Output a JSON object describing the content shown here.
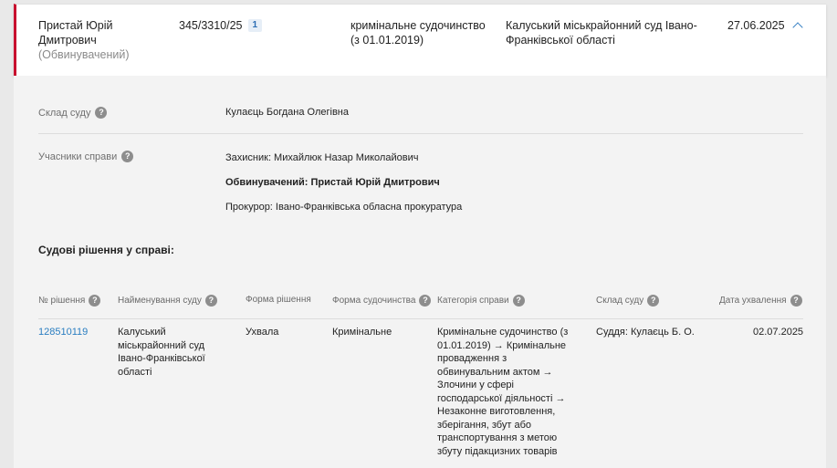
{
  "case": {
    "accused_name": "Пристай Юрій Дмитрович",
    "accused_role": "(Обвинувачений)",
    "case_number": "345/3310/25",
    "badge_count": "1",
    "proceeding_type": "кримінальне судочинство (з 01.01.2019)",
    "court": "Калуський міськрайонний суд Івано-Франківської області",
    "date": "27.06.2025"
  },
  "details": {
    "composition_label": "Склад суду",
    "composition_value": "Кулаєць Богдана Олегівна",
    "participants_label": "Учасники справи",
    "participants": [
      "Захисник: Михайлюк Назар Миколайович",
      "Обвинувачений: Пристай Юрій Дмитрович",
      "Прокурор: Івано-Франківська обласна прокуратура"
    ]
  },
  "decisions": {
    "title": "Судові рішення у справі:",
    "headers": {
      "number": "№ рішення",
      "court_name": "Найменування суду",
      "form": "Форма рішення",
      "proceeding_form": "Форма судочинства",
      "category": "Категорія справи",
      "composition": "Склад суду",
      "adopted_date": "Дата ухвалення"
    },
    "rows": [
      {
        "number": "128510119",
        "court_name": "Калуський міськрайонний суд Івано-Франківської області",
        "form": "Ухвала",
        "proceeding_form": "Кримінальне",
        "category": "Кримінальне судочинство (з 01.01.2019) → Кримінальне провадження з обвинувальним актом → Злочини у сфері господарської діяльності → Незаконне виготовлення, зберігання, збут або транспортування з метою збуту підакцизних товарів",
        "composition": "Суддя: Кулаєць Б. О.",
        "adopted_date": "02.07.2025"
      }
    ]
  },
  "icons": {
    "help": "?"
  },
  "colors": {
    "accent_red": "#c8102e",
    "link_blue": "#2a7ec1"
  }
}
